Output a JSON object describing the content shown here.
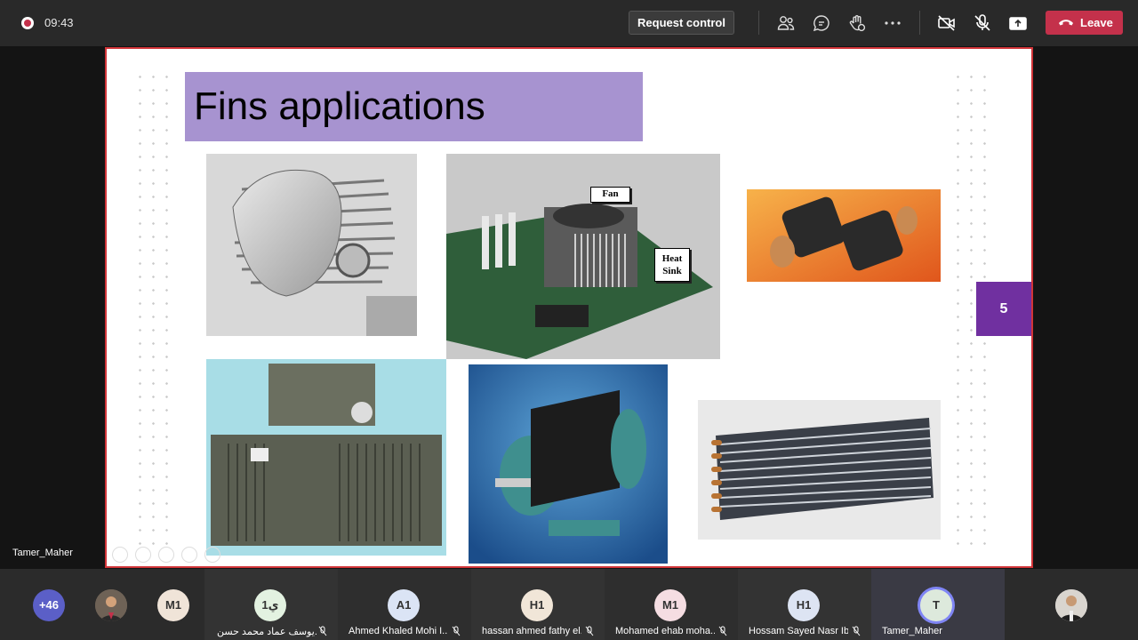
{
  "topbar": {
    "timer": "09:43",
    "request_control": "Request control",
    "leave": "Leave"
  },
  "slide": {
    "title": "Fins applications",
    "page_number": "5",
    "labels": {
      "fan": "Fan",
      "heat_sink": "Heat Sink"
    }
  },
  "presenter": {
    "name": "Tamer_Maher"
  },
  "participants": {
    "overflow": "+46",
    "items": [
      {
        "initials": "M1",
        "name": ""
      },
      {
        "initials": "1ي",
        "name": "يوسف عماد محمد حسن..."
      },
      {
        "initials": "A1",
        "name": "Ahmed Khaled Mohi I..."
      },
      {
        "initials": "H1",
        "name": "hassan ahmed fathy el..."
      },
      {
        "initials": "M1",
        "name": "Mohamed ehab moha..."
      },
      {
        "initials": "H1",
        "name": "Hossam Sayed Nasr Ib..."
      },
      {
        "initials": "T",
        "name": "Tamer_Maher"
      }
    ]
  },
  "colors": {
    "leave": "#c4314b",
    "title_bar": "#a793d0",
    "page_badge": "#7030a0",
    "slide_border": "#d13438"
  }
}
